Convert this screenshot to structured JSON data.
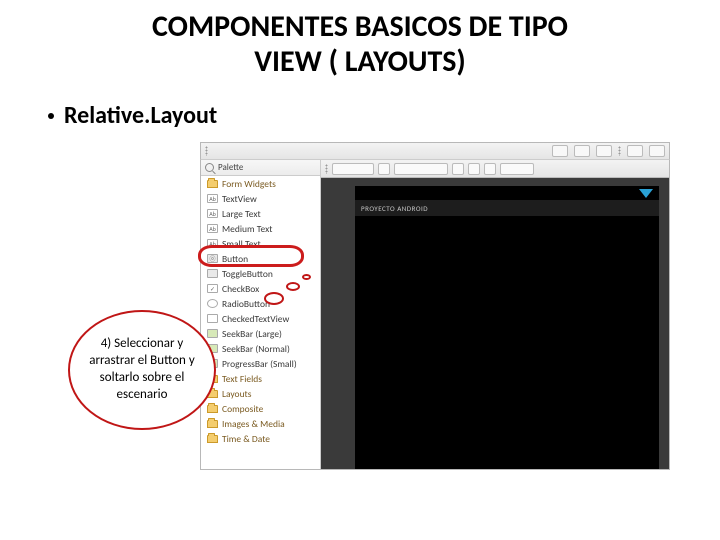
{
  "title_line1": "COMPONENTES  BASICOS DE TIPO",
  "title_line2": "VIEW ( LAYOUTS)",
  "bullet": "Relative.Layout",
  "palette": {
    "header": "Palette",
    "groups": {
      "form": "Form Widgets",
      "layouts": "Layouts",
      "composite": "Composite",
      "images": "Images & Media",
      "time": "Time & Date"
    },
    "items": {
      "textview": "TextView",
      "large": "Large Text",
      "medium": "Medium Text",
      "small": "Small Text",
      "button": "Button",
      "toggle": "ToggleButton",
      "checkbox": "CheckBox",
      "radio": "RadioButton",
      "ctextview": "CheckedTextView",
      "seekbar_l": "SeekBar (Large)",
      "seekbar_n": "SeekBar (Normal)",
      "progress_s": "ProgressBar (Small)",
      "textfields": "Text Fields"
    }
  },
  "device": {
    "title": "PROYECTO ANDROID"
  },
  "bubble": {
    "text": "4) Seleccionar  y arrastrar  el Button  y  soltarlo sobre el escenario"
  }
}
